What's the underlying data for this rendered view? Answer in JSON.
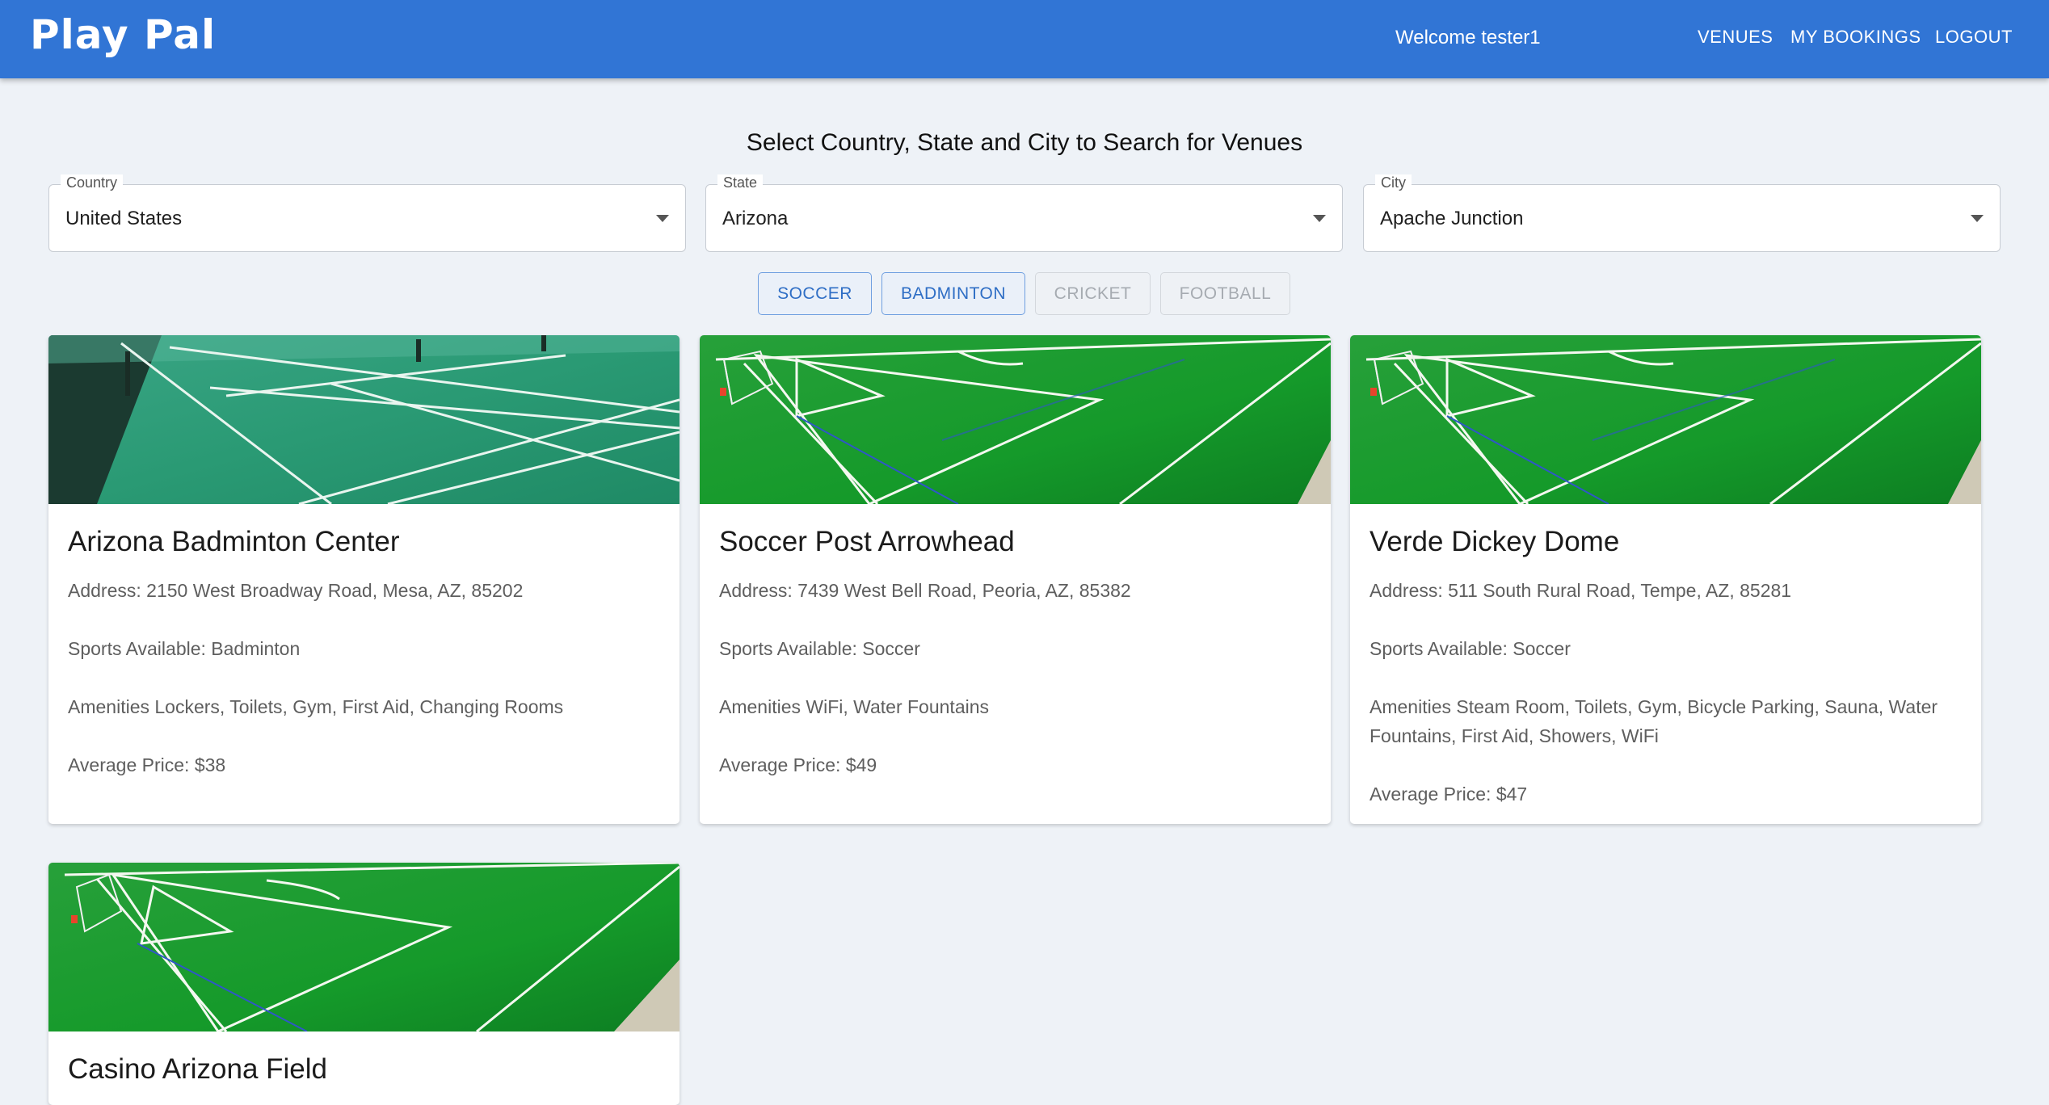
{
  "appbar": {
    "brand": "Play Pal",
    "welcome": "Welcome tester1",
    "nav": {
      "venues": "VENUES",
      "bookings": "MY BOOKINGS",
      "logout": "LOGOUT"
    }
  },
  "heading": "Select Country, State and City to Search for Venues",
  "filters": {
    "country": {
      "label": "Country",
      "value": "United States"
    },
    "state": {
      "label": "State",
      "value": "Arizona"
    },
    "city": {
      "label": "City",
      "value": "Apache Junction"
    }
  },
  "sports": [
    {
      "label": "SOCCER",
      "state": "active"
    },
    {
      "label": "BADMINTON",
      "state": "active"
    },
    {
      "label": "CRICKET",
      "state": "disabled"
    },
    {
      "label": "FOOTBALL",
      "state": "disabled"
    }
  ],
  "colors": {
    "appbar": "#3175d5",
    "chip_active": "#2f6ec5",
    "background": "#eef2f7"
  },
  "venues": [
    {
      "name": "Arizona Badminton Center",
      "address": "Address: 2150 West Broadway Road, Mesa, AZ, 85202",
      "sports": "Sports Available: Badminton",
      "amenities": "Amenities Lockers, Toilets, Gym, First Aid, Changing Rooms",
      "price": "Average Price: $38",
      "image": "badminton-court"
    },
    {
      "name": "Soccer Post Arrowhead",
      "address": "Address: 7439 West Bell Road, Peoria, AZ, 85382",
      "sports": "Sports Available: Soccer",
      "amenities": "Amenities WiFi, Water Fountains",
      "price": "Average Price: $49",
      "image": "soccer-field"
    },
    {
      "name": "Verde Dickey Dome",
      "address": "Address: 511 South Rural Road, Tempe, AZ, 85281",
      "sports": "Sports Available: Soccer",
      "amenities": "Amenities Steam Room, Toilets, Gym, Bicycle Parking, Sauna, Water Fountains, First Aid, Showers, WiFi",
      "price": "Average Price: $47",
      "image": "soccer-field"
    },
    {
      "name": "Casino Arizona Field",
      "image": "soccer-field"
    }
  ]
}
